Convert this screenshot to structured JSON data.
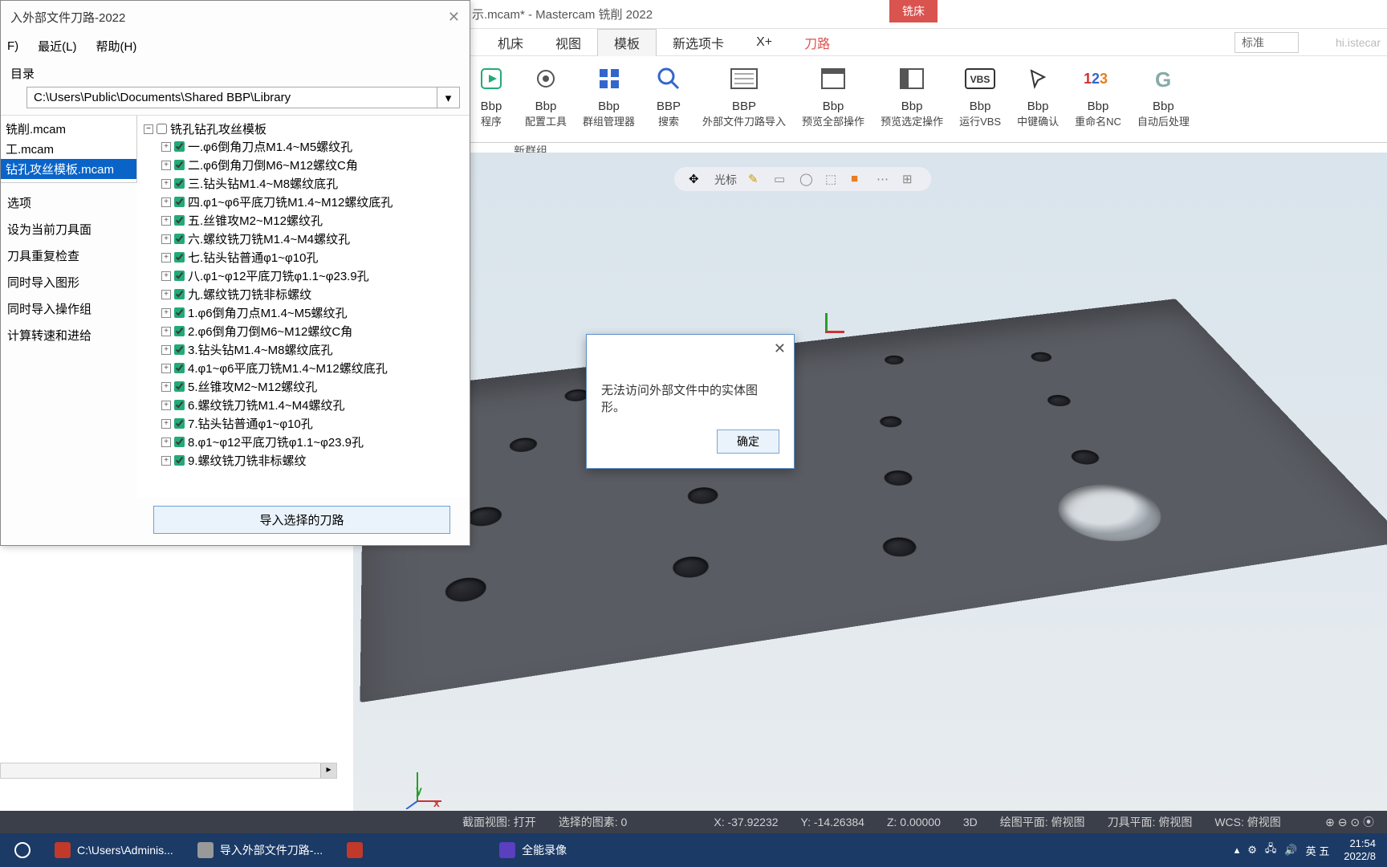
{
  "title_bar": {
    "filename": "示.mcam* - Mastercam 铣削 2022"
  },
  "accent_tab": "铣床",
  "accent_sub": "刀路",
  "ribbon": {
    "tabs": [
      "机床",
      "视图",
      "模板",
      "新选项卡",
      "X+"
    ],
    "active": "模板",
    "search": "标准",
    "right_hint": "hi.istecar",
    "buttons": [
      {
        "l1": "Bbp",
        "l2": "程序",
        "icon": "run"
      },
      {
        "l1": "Bbp",
        "l2": "配置工具",
        "icon": "gear"
      },
      {
        "l1": "Bbp",
        "l2": "群组管理器",
        "icon": "grid"
      },
      {
        "l1": "BBP",
        "l2": "搜索",
        "icon": "search"
      },
      {
        "l1": "BBP",
        "l2": "外部文件刀路导入",
        "icon": "list"
      },
      {
        "l1": "Bbp",
        "l2": "预览全部操作",
        "icon": "panel"
      },
      {
        "l1": "Bbp",
        "l2": "预览选定操作",
        "icon": "panel2"
      },
      {
        "l1": "Bbp",
        "l2": "运行VBS",
        "icon": "vbs"
      },
      {
        "l1": "Bbp",
        "l2": "中键确认",
        "icon": "cursor"
      },
      {
        "l1": "Bbp",
        "l2": "重命名NC",
        "icon": "123"
      },
      {
        "l1": "Bbp",
        "l2": "自动后处理",
        "icon": "g"
      }
    ],
    "group": "新群组"
  },
  "float_label": "光标",
  "dialog": {
    "title": "入外部文件刀路-2022",
    "menu": [
      "F)",
      "最近(L)",
      "帮助(H)"
    ],
    "path_label": "目录",
    "path_value": "C:\\Users\\Public\\Documents\\Shared BBP\\Library",
    "files": [
      "铣削.mcam",
      "工.mcam",
      "钻孔攻丝模板.mcam"
    ],
    "selected_file": 2,
    "options": [
      "选项",
      "设为当前刀具面",
      "刀具重复检查",
      "同时导入图形",
      "同时导入操作组",
      "计算转速和进给"
    ],
    "root": "铣孔钻孔攻丝模板",
    "tree": [
      "一.φ6倒角刀点M1.4~M5螺纹孔",
      "二.φ6倒角刀倒M6~M12螺纹C角",
      "三.钻头钻M1.4~M8螺纹底孔",
      "四.φ1~φ6平底刀铣M1.4~M12螺纹底孔",
      "五.丝锥攻M2~M12螺纹孔",
      "六.螺纹铣刀铣M1.4~M4螺纹孔",
      "七.钻头钻普通φ1~φ10孔",
      "八.φ1~φ12平底刀铣φ1.1~φ23.9孔",
      "九.螺纹铣刀铣非标螺纹",
      "1.φ6倒角刀点M1.4~M5螺纹孔",
      "2.φ6倒角刀倒M6~M12螺纹C角",
      "3.钻头钻M1.4~M8螺纹底孔",
      "4.φ1~φ6平底刀铣M1.4~M12螺纹底孔",
      "5.丝锥攻M2~M12螺纹孔",
      "6.螺纹铣刀铣M1.4~M4螺纹孔",
      "7.钻头钻普通φ1~φ10孔",
      "8.φ1~φ12平底刀铣φ1.1~φ23.9孔",
      "9.螺纹铣刀铣非标螺纹"
    ],
    "import_btn": "导入选择的刀路"
  },
  "alert": {
    "message": "无法访问外部文件中的实体图形。",
    "ok": "确定"
  },
  "status": {
    "sec_view": "截面视图: 打开",
    "sel_count": "选择的图素: 0",
    "x": "X: -37.92232",
    "y": "Y: -14.26384",
    "z": "Z: 0.00000",
    "mode": "3D",
    "gplane": "绘图平面: 俯视图",
    "tplane": "刀具平面: 俯视图",
    "wcs": "WCS: 俯视图"
  },
  "taskbar": {
    "items": [
      "C:\\Users\\Adminis...",
      "导入外部文件刀路-...",
      "",
      "全能录像"
    ],
    "ime": "英 五",
    "time": "21:54",
    "date": "2022/8"
  }
}
